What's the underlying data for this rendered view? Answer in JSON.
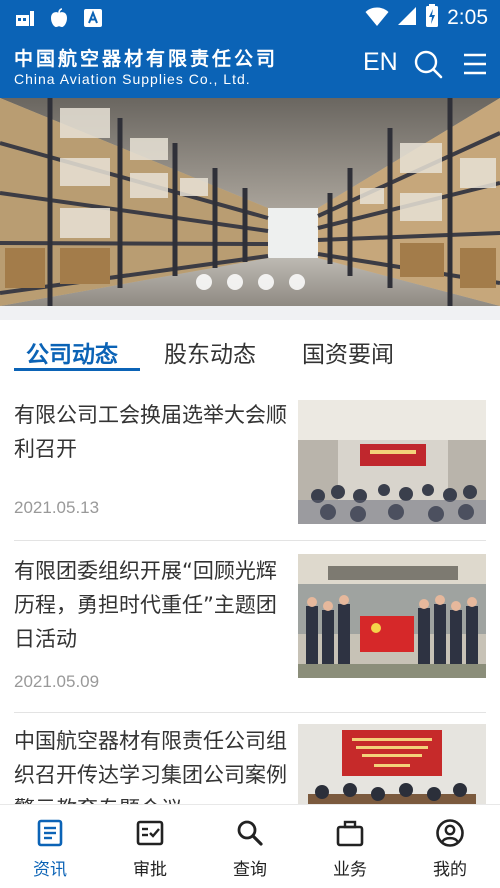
{
  "status_bar": {
    "time": "2:05",
    "left_icons": [
      "notification-app-icon",
      "apple-icon",
      "app-store-icon"
    ],
    "right_icons": [
      "wifi-icon",
      "signal-icon",
      "battery-charging-icon"
    ]
  },
  "header": {
    "company_cn": "中国航空器材有限责任公司",
    "company_en": "China Aviation Supplies Co., Ltd.",
    "lang_label": "EN",
    "icons": [
      "search-icon",
      "menu-icon"
    ],
    "brand_color": "#0b63b6"
  },
  "banner": {
    "slide_count": 4,
    "active_slide": 1
  },
  "tabs": [
    {
      "label": "公司动态",
      "active": true
    },
    {
      "label": "股东动态",
      "active": false
    },
    {
      "label": "国资要闻",
      "active": false
    }
  ],
  "news": [
    {
      "title": "有限公司工会换届选举大会顺利召开",
      "date": "2021.05.13"
    },
    {
      "title": "有限团委组织开展“回顾光辉历程，勇担时代重任”主题团日活动",
      "date": "2021.05.09"
    },
    {
      "title": "中国航空器材有限责任公司组织召开传达学习集团公司案例警示教育专题会议",
      "date": ""
    }
  ],
  "bottom_nav": [
    {
      "label": "资讯",
      "icon": "article-icon",
      "active": true
    },
    {
      "label": "审批",
      "icon": "approval-icon",
      "active": false
    },
    {
      "label": "查询",
      "icon": "search-icon",
      "active": false
    },
    {
      "label": "业务",
      "icon": "briefcase-icon",
      "active": false
    },
    {
      "label": "我的",
      "icon": "account-icon",
      "active": false
    }
  ]
}
